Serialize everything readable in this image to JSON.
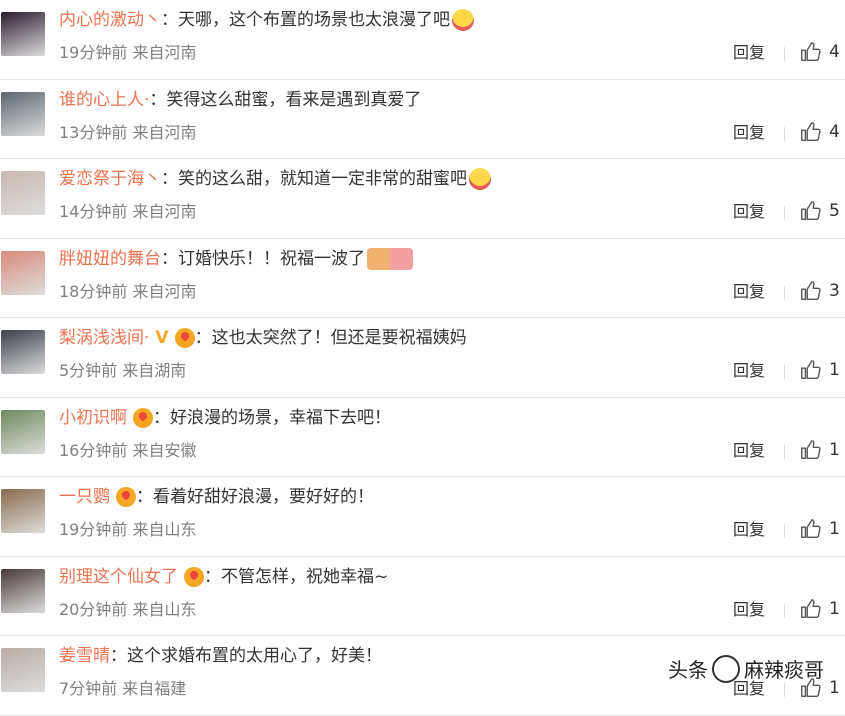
{
  "comments": [
    {
      "user": "内心的激动丶",
      "text": "天哪，这个布置的场景也太浪漫了吧",
      "emoji": "scream-emoji",
      "badges": [],
      "time": "19分钟前",
      "location": "来自河南",
      "likes": "4",
      "avatar_color": "#2a1a2e"
    },
    {
      "user": "谁的心上人·",
      "text": "笑得这么甜蜜，看来是遇到真爱了",
      "emoji": null,
      "badges": [],
      "time": "13分钟前",
      "location": "来自河南",
      "likes": "4",
      "avatar_color": "#5b6670"
    },
    {
      "user": "爱恋祭于海丶",
      "text": "笑的这么甜，就知道一定非常的甜蜜吧",
      "emoji": "scream-emoji",
      "badges": [],
      "time": "14分钟前",
      "location": "来自河南",
      "likes": "5",
      "avatar_color": "#c9b8b0"
    },
    {
      "user": "胖妞妞的舞台",
      "text": "订婚快乐！！祝福一波了",
      "emoji": "kiss-couple-emoji",
      "badges": [],
      "time": "18分钟前",
      "location": "来自河南",
      "likes": "3",
      "avatar_color": "#d98b7a"
    },
    {
      "user": "梨涡浅浅间·",
      "text": "这也太突然了！但还是要祝福姨妈",
      "emoji": null,
      "badges": [
        "v-badge",
        "heart-badge"
      ],
      "time": "5分钟前",
      "location": "来自湖南",
      "likes": "1",
      "avatar_color": "#3a3f4a"
    },
    {
      "user": "小初识啊",
      "text": "好浪漫的场景，幸福下去吧！",
      "emoji": null,
      "badges": [
        "heart-badge"
      ],
      "time": "16分钟前",
      "location": "来自安徽",
      "likes": "1",
      "avatar_color": "#6f8a5a"
    },
    {
      "user": "一只鹦",
      "text": "看着好甜好浪漫，要好好的！",
      "emoji": null,
      "badges": [
        "heart-badge"
      ],
      "time": "19分钟前",
      "location": "来自山东",
      "likes": "1",
      "avatar_color": "#8a6a4a"
    },
    {
      "user": "别理这个仙女了",
      "text": "不管怎样，祝她幸福~",
      "emoji": null,
      "badges": [
        "heart-badge"
      ],
      "time": "20分钟前",
      "location": "来自山东",
      "likes": "1",
      "avatar_color": "#4a3a3a"
    },
    {
      "user": "姜雪晴",
      "text": "这个求婚布置的太用心了，好美！",
      "emoji": null,
      "badges": [],
      "time": "7分钟前",
      "location": "来自福建",
      "likes": "1",
      "avatar_color": "#b8aca4"
    }
  ],
  "ui": {
    "reply_label": "回复",
    "colon": "："
  },
  "watermark": {
    "prefix": "头条",
    "name": "麻辣痰哥"
  }
}
